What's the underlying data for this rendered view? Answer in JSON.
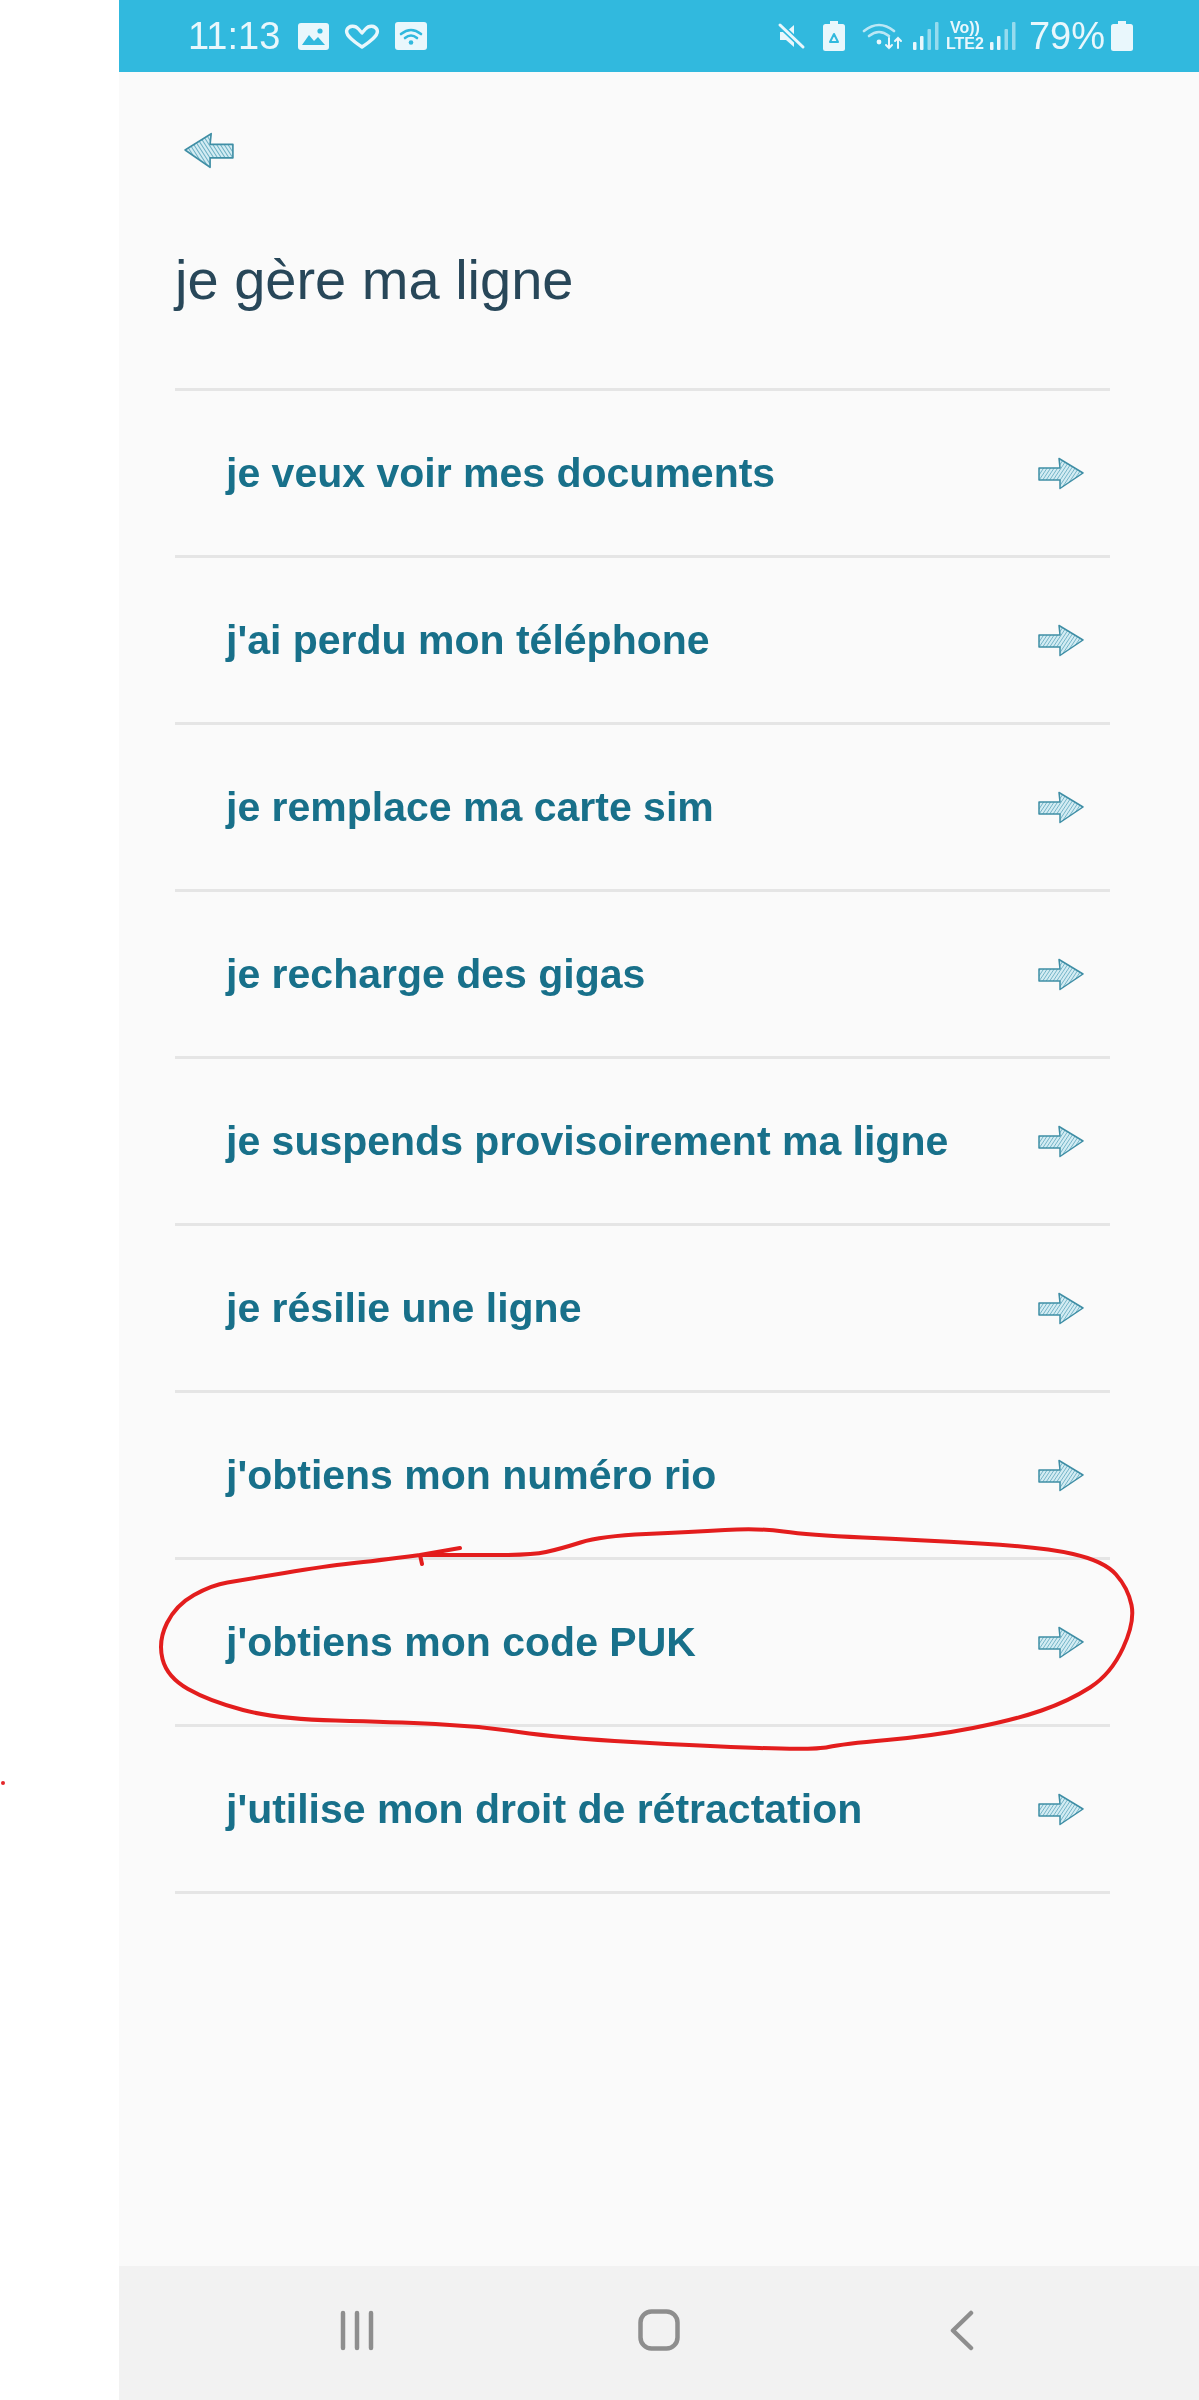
{
  "status_bar": {
    "time": "11:13",
    "volte_label": "Vo))",
    "network_label": "LTE2",
    "battery_percent": "79%"
  },
  "header": {
    "title": "je gère ma ligne"
  },
  "menu": {
    "items": [
      {
        "label": "je veux voir mes documents",
        "circled": false
      },
      {
        "label": "j'ai perdu mon téléphone",
        "circled": false
      },
      {
        "label": "je remplace ma carte sim",
        "circled": false
      },
      {
        "label": "je recharge des gigas",
        "circled": false
      },
      {
        "label": "je suspends provisoirement ma ligne",
        "circled": false
      },
      {
        "label": "je résilie une ligne",
        "circled": false
      },
      {
        "label": "j'obtiens mon numéro rio",
        "circled": false
      },
      {
        "label": "j'obtiens mon code PUK",
        "circled": true
      },
      {
        "label": "j'utilise mon droit de rétractation",
        "circled": false
      }
    ]
  }
}
